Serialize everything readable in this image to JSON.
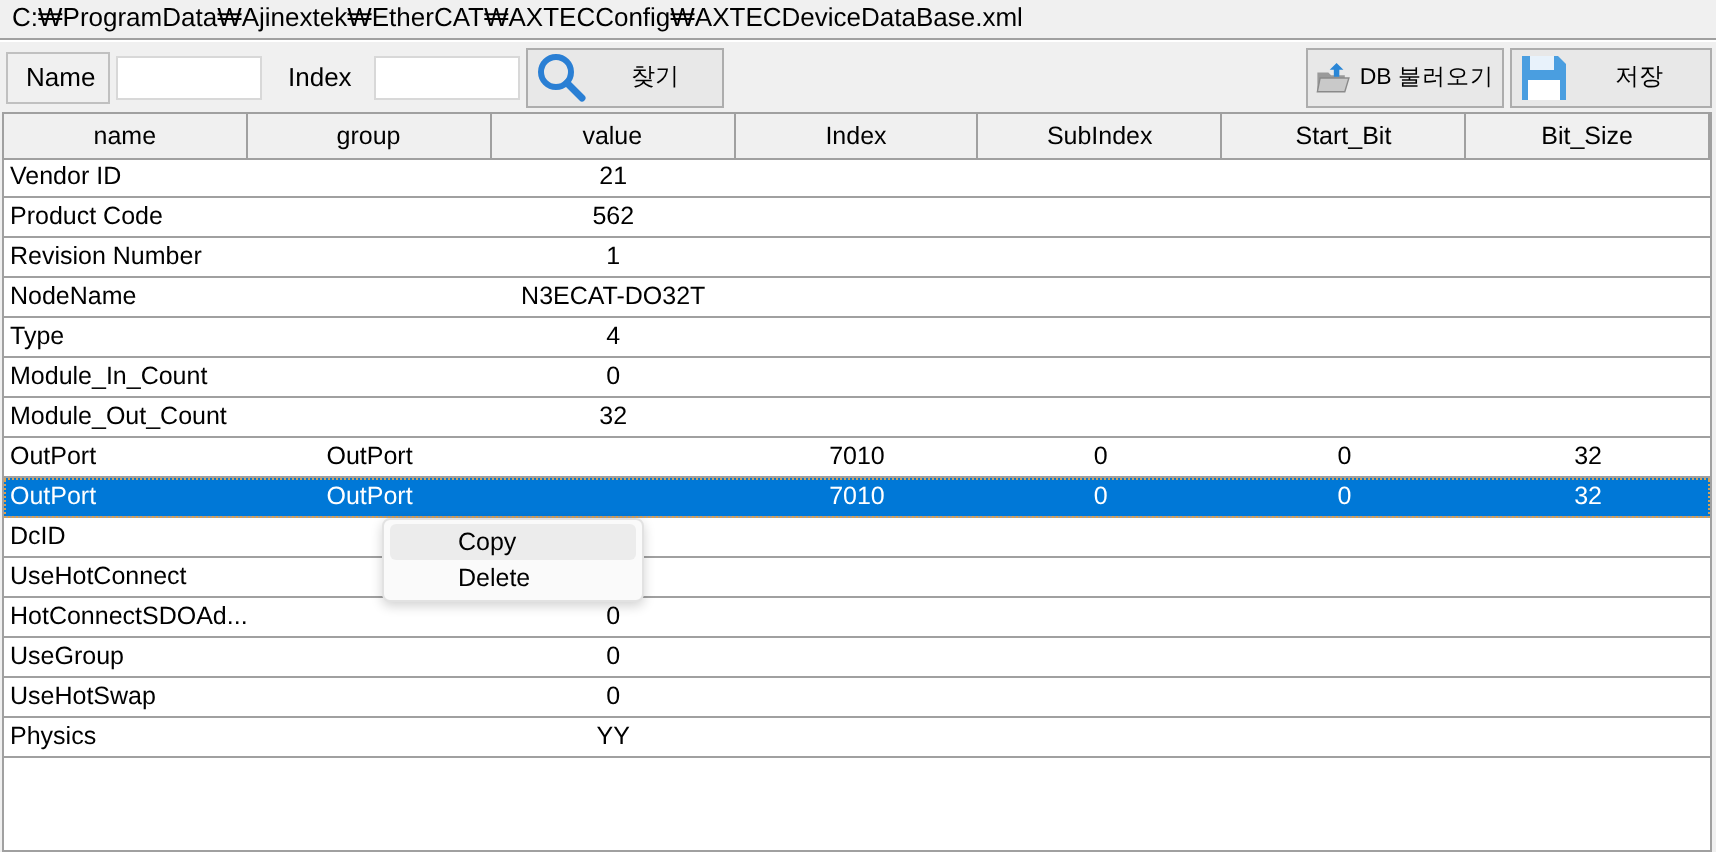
{
  "path_bar": {
    "text": "C:₩ProgramData₩Ajinextek₩EtherCAT₩AXTECConfig₩AXTECDeviceDataBase.xml"
  },
  "toolbar": {
    "name_label": "Name",
    "index_label": "Index",
    "search_button": "찾기",
    "load_button": "DB 불러오기",
    "save_button": "저장"
  },
  "table": {
    "columns": [
      "name",
      "group",
      "value",
      "Index",
      "SubIndex",
      "Start_Bit",
      "Bit_Size"
    ],
    "rows": [
      {
        "name": "Vendor ID",
        "value": "21",
        "selected": false
      },
      {
        "name": "Product Code",
        "value": "562",
        "selected": false
      },
      {
        "name": "Revision Number",
        "value": "1",
        "selected": false
      },
      {
        "name": "NodeName",
        "value": "N3ECAT-DO32T",
        "selected": false
      },
      {
        "name": "Type",
        "value": "4",
        "selected": false
      },
      {
        "name": "Module_In_Count",
        "value": "0",
        "selected": false
      },
      {
        "name": "Module_Out_Count",
        "value": "32",
        "selected": false
      },
      {
        "name": "OutPort",
        "group": "OutPort",
        "index": "7010",
        "subindex": "0",
        "start_bit": "0",
        "bit_size": "32",
        "selected": false
      },
      {
        "name": "OutPort",
        "group": "OutPort",
        "index": "7010",
        "subindex": "0",
        "start_bit": "0",
        "bit_size": "32",
        "selected": true
      },
      {
        "name": "DcID",
        "selected": false
      },
      {
        "name": "UseHotConnect",
        "selected": false
      },
      {
        "name": "HotConnectSDOAd...",
        "value": "0",
        "selected": false
      },
      {
        "name": "UseGroup",
        "value": "0",
        "selected": false
      },
      {
        "name": "UseHotSwap",
        "value": "0",
        "selected": false
      },
      {
        "name": "Physics",
        "value": "YY",
        "selected": false
      }
    ]
  },
  "context_menu": {
    "items": [
      {
        "label": "Copy",
        "selected": true
      },
      {
        "label": "Delete",
        "selected": false
      }
    ]
  }
}
